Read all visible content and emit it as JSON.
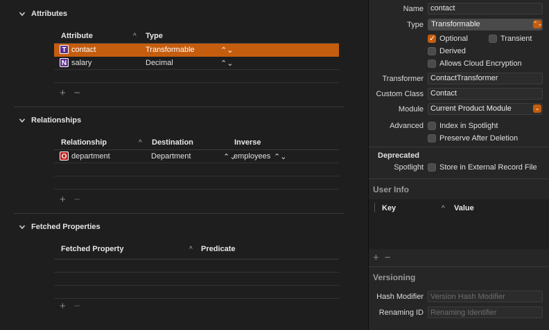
{
  "sections": {
    "attributes": {
      "title": "Attributes",
      "columns": [
        "Attribute",
        "Type"
      ],
      "rows": [
        {
          "badge": "T",
          "name": "contact",
          "type": "Transformable",
          "selected": true
        },
        {
          "badge": "N",
          "name": "salary",
          "type": "Decimal",
          "selected": false
        }
      ]
    },
    "relationships": {
      "title": "Relationships",
      "columns": [
        "Relationship",
        "Destination",
        "Inverse"
      ],
      "rows": [
        {
          "badge": "O",
          "name": "department",
          "destination": "Department",
          "inverse": "employees"
        }
      ]
    },
    "fetched": {
      "title": "Fetched Properties",
      "columns": [
        "Fetched Property",
        "Predicate"
      ]
    }
  },
  "controls": {
    "plus": "+",
    "minus": "−",
    "sort_caret": "^",
    "updown": "⌃⌄"
  },
  "inspector": {
    "name_label": "Name",
    "name_value": "contact",
    "type_label": "Type",
    "type_value": "Transformable",
    "optional_label": "Optional",
    "optional_checked": true,
    "transient_label": "Transient",
    "transient_checked": false,
    "derived_label": "Derived",
    "derived_checked": false,
    "cloud_label": "Allows Cloud Encryption",
    "cloud_checked": false,
    "transformer_label": "Transformer",
    "transformer_value": "ContactTransformer",
    "custom_class_label": "Custom Class",
    "custom_class_value": "Contact",
    "module_label": "Module",
    "module_value": "Current Product Module",
    "advanced_label": "Advanced",
    "spotlight_label": "Index in Spotlight",
    "spotlight_checked": false,
    "preserve_label": "Preserve After Deletion",
    "preserve_checked": false,
    "deprecated_label": "Deprecated",
    "spotlight_row_label": "Spotlight",
    "external_label": "Store in External Record File",
    "external_checked": false,
    "user_info_title": "User Info",
    "user_info_columns": [
      "Key",
      "Value"
    ],
    "versioning_title": "Versioning",
    "hash_label": "Hash Modifier",
    "hash_placeholder": "Version Hash Modifier",
    "renaming_label": "Renaming ID",
    "renaming_placeholder": "Renaming Identifier"
  },
  "colors": {
    "accent": "#c55d0e",
    "badge_purple": "#5b2d8c",
    "badge_red": "#b81c1c"
  }
}
